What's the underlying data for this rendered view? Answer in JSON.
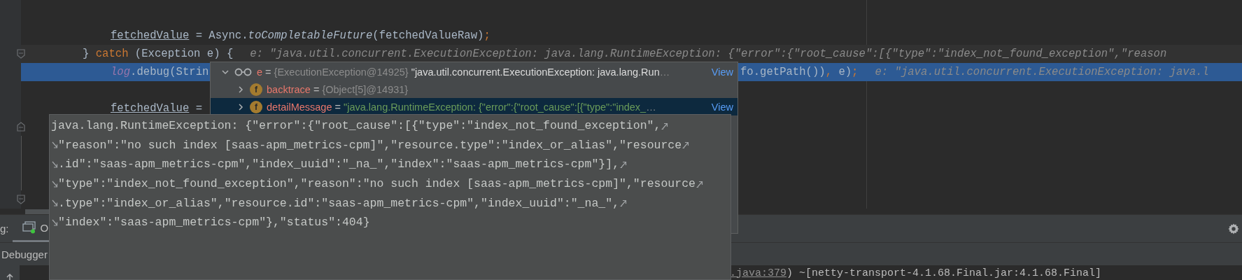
{
  "editor": {
    "lines": [
      {
        "kind": "plain",
        "selected": false,
        "caret_line": false
      },
      {
        "kind": "plain",
        "indented": true,
        "selected": false,
        "caret_line": false,
        "segments": [
          {
            "text": "fetchedValue",
            "kind": "underlined"
          },
          {
            "text": " = Async.",
            "kind": "plain"
          },
          {
            "text": "toCompletableFuture",
            "kind": "italic"
          },
          {
            "text": "(fetchedValueRaw)",
            "kind": "plain"
          },
          {
            "text": ";",
            "kind": "keyword"
          }
        ]
      },
      {
        "kind": "fold_end",
        "indented": false,
        "selected": false,
        "caret_line": true,
        "segments": [
          {
            "text": "} ",
            "kind": "plain"
          },
          {
            "text": "catch",
            "kind": "keyword"
          },
          {
            "text": " (Exception e) {",
            "kind": "plain"
          }
        ],
        "hint": "e: \"java.util.concurrent.ExecutionException: java.lang.RuntimeException: {\"error\":{\"root_cause\":[{\"type\":\"index_not_found_exception\",\"reason"
      },
      {
        "kind": "plain",
        "indented": true,
        "selected": true,
        "caret_line": false,
        "segments": [
          {
            "text": "log",
            "kind": "static_field"
          },
          {
            "text": ".debug(Strin",
            "kind": "plain"
          }
        ],
        "tail_segments": [
          {
            "text": "fo.getPath())",
            "kind": "plain"
          },
          {
            "text": ", ",
            "kind": "keyword"
          },
          {
            "text": "e)",
            "kind": "plain"
          },
          {
            "text": ";",
            "kind": "keyword"
          }
        ],
        "hint": "e: \"java.util.concurrent.ExecutionException: java.l"
      },
      {
        "kind": "plain",
        "selected": false,
        "caret_line": false
      },
      {
        "kind": "plain",
        "indented": true,
        "selected": false,
        "caret_line": false,
        "segments": [
          {
            "text": "fetchedValue",
            "kind": "underlined"
          },
          {
            "text": " =",
            "kind": "plain"
          }
        ]
      },
      {
        "kind": "fold_start",
        "selected": false,
        "caret_line": false
      },
      {
        "kind": "fold_inside",
        "selected": false,
        "caret_line": false
      },
      {
        "kind": "fold_inside",
        "selected": false,
        "caret_line": false
      },
      {
        "kind": "fold_inside",
        "selected": false,
        "caret_line": false
      },
      {
        "kind": "fold_end",
        "selected": false,
        "caret_line": false
      }
    ]
  },
  "debug_popup": {
    "nodes": [
      {
        "kind": "watch",
        "expanded": true,
        "name": "e",
        "operator": "=",
        "type_ref": "{ExecutionException@14925}",
        "value": {
          "text": "\"java.util.concurrent.ExecutionException: java.lang.Run",
          "kind": "tostring"
        },
        "ellipsis": "…",
        "link": "View",
        "selected": false,
        "children": [
          {
            "kind": "field",
            "expanded": false,
            "badge": "f",
            "name": "backtrace",
            "operator": "=",
            "type_ref": "{Object[5]@14931}",
            "selected": false
          },
          {
            "kind": "field",
            "expanded": false,
            "badge": "f",
            "name": "detailMessage",
            "operator": "=",
            "value": {
              "text": "\"java.lang.RuntimeException: {\"error\":{\"root_cause\":[{\"type\":\"index_",
              "kind": "string"
            },
            "ellipsis": "…",
            "link": "View",
            "selected": true
          }
        ]
      }
    ]
  },
  "text_popup": {
    "lines": [
      {
        "text": "java.lang.RuntimeException: {\"error\":{\"root_cause\":[{\"type\":\"index_not_found_exception\",",
        "wrap_start": false,
        "wrap_end": true
      },
      {
        "text": "\"reason\":\"no such index [saas-apm_metrics-cpm]\",\"resource.type\":\"index_or_alias\",\"resource",
        "wrap_start": true,
        "wrap_end": true
      },
      {
        "text": ".id\":\"saas-apm_metrics-cpm\",\"index_uuid\":\"_na_\",\"index\":\"saas-apm_metrics-cpm\"}],",
        "wrap_start": true,
        "wrap_end": true
      },
      {
        "text": "\"type\":\"index_not_found_exception\",\"reason\":\"no such index [saas-apm_metrics-cpm]\",\"resource",
        "wrap_start": true,
        "wrap_end": true
      },
      {
        "text": ".type\":\"index_or_alias\",\"resource.id\":\"saas-apm_metrics-cpm\",\"index_uuid\":\"_na_\",",
        "wrap_start": true,
        "wrap_end": true
      },
      {
        "text": "\"index\":\"saas-apm_metrics-cpm\"},\"status\":404}",
        "wrap_start": true,
        "wrap_end": false
      }
    ]
  },
  "tool_window": {
    "label": "g:",
    "tabs": [
      {
        "label": "O",
        "selected": true
      }
    ]
  },
  "debugger_bar": {
    "tabs": [
      {
        "label": "Debugger"
      }
    ]
  },
  "console": {
    "segments": [
      {
        "text": ".java:379",
        "kind": "link"
      },
      {
        "text": ") ~[netty-transport-4.1.68.Final.jar:4.1.68.Final]",
        "kind": "plain"
      }
    ]
  }
}
